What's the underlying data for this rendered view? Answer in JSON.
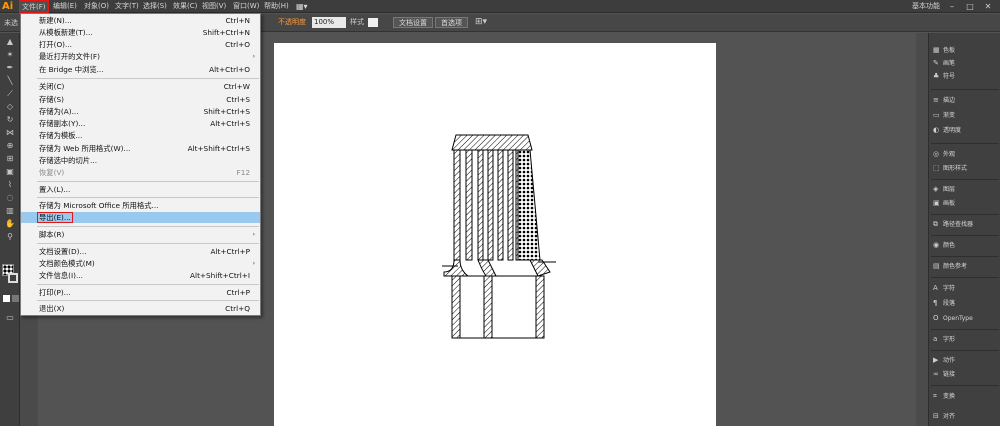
{
  "app": {
    "logo": "Ai"
  },
  "menubar": {
    "items": [
      "文件(F)",
      "编辑(E)",
      "对象(O)",
      "文字(T)",
      "选择(S)",
      "效果(C)",
      "视图(V)",
      "窗口(W)",
      "帮助(H)"
    ],
    "workspace": "基本功能"
  },
  "control_bar": {
    "selection_status": "未选",
    "mode_label": "不透明度",
    "zoom_value": "100%",
    "style_label": "样式",
    "doc_setup_button": "文档设置",
    "prefs_button": "首选项"
  },
  "file_menu": {
    "items": [
      {
        "label": "新建(N)...",
        "shortcut": "Ctrl+N"
      },
      {
        "label": "从模板新建(T)...",
        "shortcut": "Shift+Ctrl+N"
      },
      {
        "label": "打开(O)...",
        "shortcut": "Ctrl+O"
      },
      {
        "label": "最近打开的文件(F)",
        "shortcut": ""
      },
      {
        "label": "在 Bridge 中浏览...",
        "shortcut": "Alt+Ctrl+O"
      },
      {
        "label": "关闭(C)",
        "shortcut": "Ctrl+W"
      },
      {
        "label": "存储(S)",
        "shortcut": "Ctrl+S"
      },
      {
        "label": "存储为(A)...",
        "shortcut": "Shift+Ctrl+S"
      },
      {
        "label": "存储副本(Y)...",
        "shortcut": "Alt+Ctrl+S"
      },
      {
        "label": "存储为模板...",
        "shortcut": ""
      },
      {
        "label": "存储为 Web 所用格式(W)...",
        "shortcut": "Alt+Shift+Ctrl+S"
      },
      {
        "label": "存储选中的切片...",
        "shortcut": ""
      },
      {
        "label": "恢复(V)",
        "shortcut": "F12"
      },
      {
        "label": "置入(L)...",
        "shortcut": ""
      },
      {
        "label": "存储为 Microsoft Office 所用格式...",
        "shortcut": ""
      },
      {
        "label": "导出(E)...",
        "shortcut": ""
      },
      {
        "label": "脚本(R)",
        "shortcut": ""
      },
      {
        "label": "文档设置(D)...",
        "shortcut": "Alt+Ctrl+P"
      },
      {
        "label": "文档颜色模式(M)",
        "shortcut": ""
      },
      {
        "label": "文件信息(I)...",
        "shortcut": "Alt+Shift+Ctrl+I"
      },
      {
        "label": "打印(P)...",
        "shortcut": "Ctrl+P"
      },
      {
        "label": "退出(X)",
        "shortcut": "Ctrl+Q"
      }
    ]
  },
  "right_panel": {
    "items": [
      "色板",
      "画笔",
      "符号",
      "描边",
      "渐变",
      "透明度",
      "外观",
      "图形样式",
      "图层",
      "画板",
      "路径查找器",
      "颜色",
      "颜色参考",
      "字符",
      "段落",
      "OpenType",
      "字形",
      "动作",
      "链接",
      "变换",
      "对齐"
    ]
  },
  "colors": {
    "accent": "#ff9a00",
    "highlight": "#99c9ef",
    "annotation": "#e01818"
  }
}
